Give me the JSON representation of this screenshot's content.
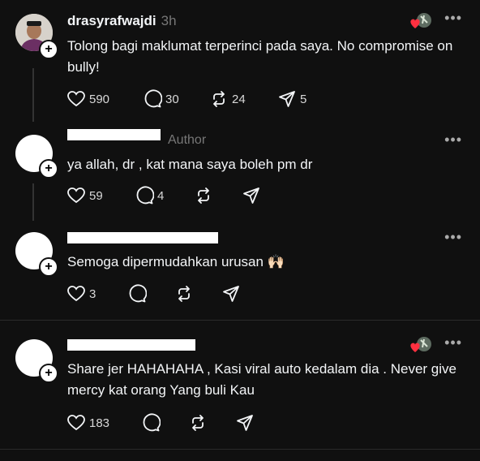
{
  "posts": [
    {
      "username": "drasyrafwajdi",
      "time": "3h",
      "text": "Tolong bagi maklumat terperinci pada saya. No compromise on bully!",
      "likes": "590",
      "replies": "30",
      "reposts": "24",
      "shares": "5"
    },
    {
      "author_label": "Author",
      "text": "ya allah, dr , kat mana saya boleh pm dr",
      "likes": "59",
      "replies": "4"
    },
    {
      "text": "Semoga dipermudahkan urusan",
      "emoji": "🙌🏻",
      "likes": "3"
    },
    {
      "text": "Share jer HAHAHAHA , Kasi viral auto kedalam dia . Never give mercy kat orang Yang buli Kau",
      "likes": "183"
    }
  ],
  "icons": {
    "like": "heart-icon",
    "reply": "comment-icon",
    "repost": "repost-icon",
    "share": "send-icon",
    "more": "more-options-icon"
  },
  "colors": {
    "background": "#101010",
    "text": "#f3f5f7",
    "muted": "#777777",
    "heart_red": "#ff3040"
  }
}
